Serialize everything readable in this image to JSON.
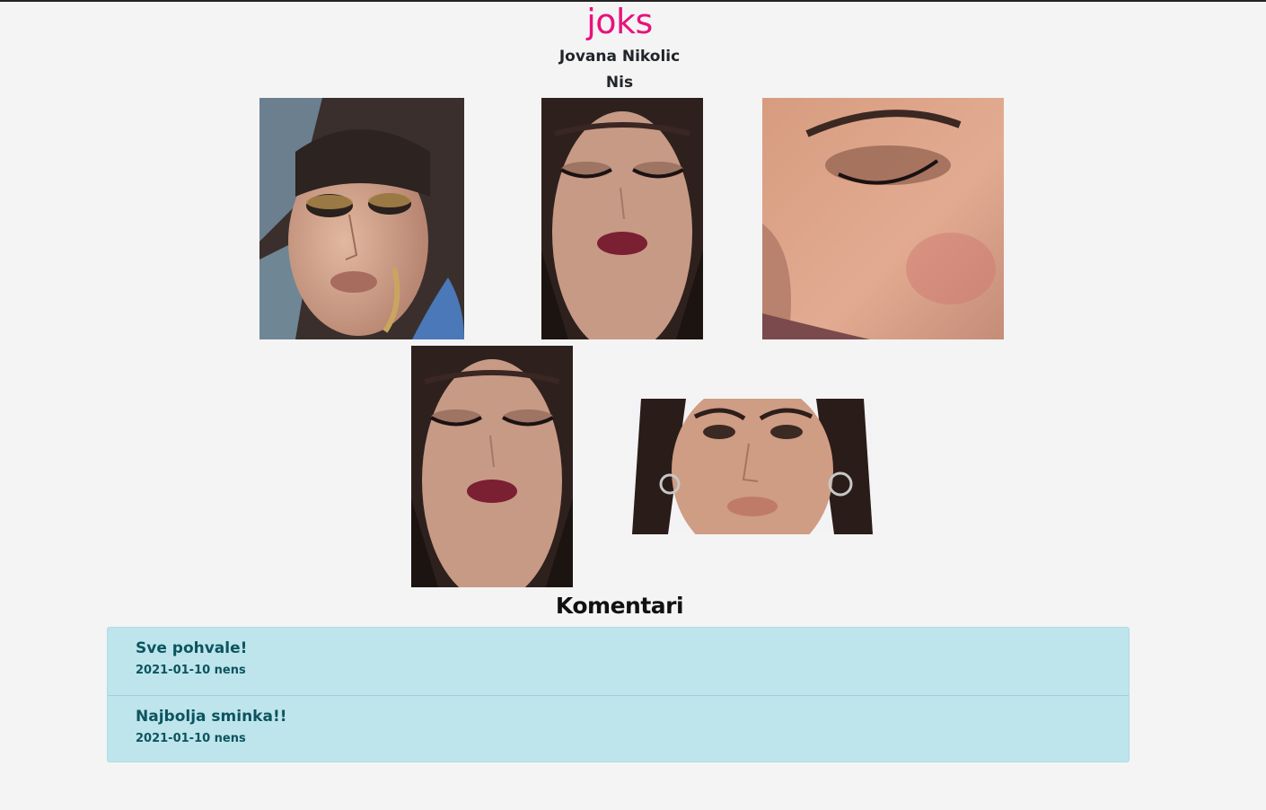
{
  "header": {
    "brand": "joks",
    "artist_name": "Jovana Nikolic",
    "city": "Nis"
  },
  "gallery": {
    "photos": [
      {
        "description": "makeup-photo-gold-smokey-eye"
      },
      {
        "description": "makeup-photo-burgundy-lips"
      },
      {
        "description": "makeup-photo-closeup-eye"
      },
      {
        "description": "makeup-photo-burgundy-lips"
      },
      {
        "description": "makeup-photo-hoop-earrings"
      }
    ]
  },
  "comments": {
    "title": "Komentari",
    "items": [
      {
        "text": "Sve pohvale!",
        "meta": "2021-01-10 nens"
      },
      {
        "text": "Najbolja sminka!!",
        "meta": "2021-01-10 nens"
      }
    ]
  },
  "colors": {
    "brand": "#e8127c",
    "page_background": "#f4f4f4",
    "comment_background": "#bee5eb",
    "comment_text": "#0c5460"
  }
}
